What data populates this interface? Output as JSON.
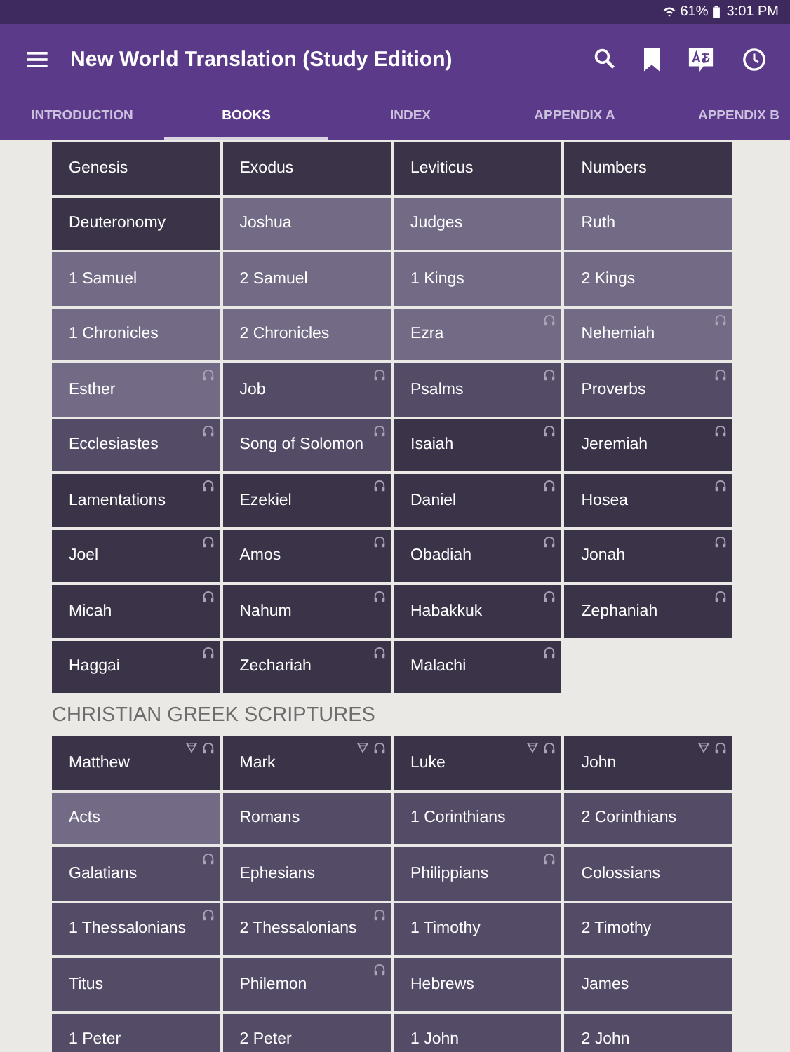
{
  "status_bar": {
    "battery": "61%",
    "time": "3:01 PM"
  },
  "app_bar": {
    "title": "New World Translation (Study Edition)"
  },
  "tabs": [
    {
      "label": "INTRODUCTION",
      "selected": false
    },
    {
      "label": "BOOKS",
      "selected": true
    },
    {
      "label": "INDEX",
      "selected": false
    },
    {
      "label": "APPENDIX A",
      "selected": false
    },
    {
      "label": "APPENDIX B",
      "selected": false
    }
  ],
  "sections": [
    {
      "books": [
        {
          "name": "Genesis",
          "color": "#3b3448",
          "audio": false,
          "study": false
        },
        {
          "name": "Exodus",
          "color": "#3b3448",
          "audio": false,
          "study": false
        },
        {
          "name": "Leviticus",
          "color": "#3b3448",
          "audio": false,
          "study": false
        },
        {
          "name": "Numbers",
          "color": "#3b3448",
          "audio": false,
          "study": false
        },
        {
          "name": "Deuteronomy",
          "color": "#3b3448",
          "audio": false,
          "study": false
        },
        {
          "name": "Joshua",
          "color": "#736a85",
          "audio": false,
          "study": false
        },
        {
          "name": "Judges",
          "color": "#736a85",
          "audio": false,
          "study": false
        },
        {
          "name": "Ruth",
          "color": "#736a85",
          "audio": false,
          "study": false
        },
        {
          "name": "1 Samuel",
          "color": "#736a85",
          "audio": false,
          "study": false
        },
        {
          "name": "2 Samuel",
          "color": "#736a85",
          "audio": false,
          "study": false
        },
        {
          "name": "1 Kings",
          "color": "#736a85",
          "audio": false,
          "study": false
        },
        {
          "name": "2 Kings",
          "color": "#736a85",
          "audio": false,
          "study": false
        },
        {
          "name": "1 Chronicles",
          "color": "#736a85",
          "audio": false,
          "study": false
        },
        {
          "name": "2 Chronicles",
          "color": "#736a85",
          "audio": false,
          "study": false
        },
        {
          "name": "Ezra",
          "color": "#736a85",
          "audio": true,
          "study": false
        },
        {
          "name": "Nehemiah",
          "color": "#736a85",
          "audio": true,
          "study": false
        },
        {
          "name": "Esther",
          "color": "#736a85",
          "audio": true,
          "study": false
        },
        {
          "name": "Job",
          "color": "#544b66",
          "audio": true,
          "study": false
        },
        {
          "name": "Psalms",
          "color": "#544b66",
          "audio": true,
          "study": false
        },
        {
          "name": "Proverbs",
          "color": "#544b66",
          "audio": true,
          "study": false
        },
        {
          "name": "Ecclesiastes",
          "color": "#544b66",
          "audio": true,
          "study": false
        },
        {
          "name": "Song of Solomon",
          "color": "#544b66",
          "audio": true,
          "study": false
        },
        {
          "name": "Isaiah",
          "color": "#3b3448",
          "audio": true,
          "study": false
        },
        {
          "name": "Jeremiah",
          "color": "#3b3448",
          "audio": true,
          "study": false
        },
        {
          "name": "Lamentations",
          "color": "#3b3448",
          "audio": true,
          "study": false
        },
        {
          "name": "Ezekiel",
          "color": "#3b3448",
          "audio": true,
          "study": false
        },
        {
          "name": "Daniel",
          "color": "#3b3448",
          "audio": true,
          "study": false
        },
        {
          "name": "Hosea",
          "color": "#3b3448",
          "audio": true,
          "study": false
        },
        {
          "name": "Joel",
          "color": "#3b3448",
          "audio": true,
          "study": false
        },
        {
          "name": "Amos",
          "color": "#3b3448",
          "audio": true,
          "study": false
        },
        {
          "name": "Obadiah",
          "color": "#3b3448",
          "audio": true,
          "study": false
        },
        {
          "name": "Jonah",
          "color": "#3b3448",
          "audio": true,
          "study": false
        },
        {
          "name": "Micah",
          "color": "#3b3448",
          "audio": true,
          "study": false
        },
        {
          "name": "Nahum",
          "color": "#3b3448",
          "audio": true,
          "study": false
        },
        {
          "name": "Habakkuk",
          "color": "#3b3448",
          "audio": true,
          "study": false
        },
        {
          "name": "Zephaniah",
          "color": "#3b3448",
          "audio": true,
          "study": false
        },
        {
          "name": "Haggai",
          "color": "#3b3448",
          "audio": true,
          "study": false
        },
        {
          "name": "Zechariah",
          "color": "#3b3448",
          "audio": true,
          "study": false
        },
        {
          "name": "Malachi",
          "color": "#3b3448",
          "audio": true,
          "study": false
        }
      ]
    },
    {
      "heading": "CHRISTIAN GREEK SCRIPTURES",
      "books": [
        {
          "name": "Matthew",
          "color": "#3b3448",
          "audio": true,
          "study": true
        },
        {
          "name": "Mark",
          "color": "#3b3448",
          "audio": true,
          "study": true
        },
        {
          "name": "Luke",
          "color": "#3b3448",
          "audio": true,
          "study": true
        },
        {
          "name": "John",
          "color": "#3b3448",
          "audio": true,
          "study": true
        },
        {
          "name": "Acts",
          "color": "#736a85",
          "audio": false,
          "study": false
        },
        {
          "name": "Romans",
          "color": "#544b66",
          "audio": false,
          "study": false
        },
        {
          "name": "1 Corinthians",
          "color": "#544b66",
          "audio": false,
          "study": false
        },
        {
          "name": "2 Corinthians",
          "color": "#544b66",
          "audio": false,
          "study": false
        },
        {
          "name": "Galatians",
          "color": "#544b66",
          "audio": true,
          "study": false
        },
        {
          "name": "Ephesians",
          "color": "#544b66",
          "audio": false,
          "study": false
        },
        {
          "name": "Philippians",
          "color": "#544b66",
          "audio": true,
          "study": false
        },
        {
          "name": "Colossians",
          "color": "#544b66",
          "audio": false,
          "study": false
        },
        {
          "name": "1 Thessalonians",
          "color": "#544b66",
          "audio": true,
          "study": false
        },
        {
          "name": "2 Thessalonians",
          "color": "#544b66",
          "audio": true,
          "study": false
        },
        {
          "name": "1 Timothy",
          "color": "#544b66",
          "audio": false,
          "study": false
        },
        {
          "name": "2 Timothy",
          "color": "#544b66",
          "audio": false,
          "study": false
        },
        {
          "name": "Titus",
          "color": "#544b66",
          "audio": false,
          "study": false
        },
        {
          "name": "Philemon",
          "color": "#544b66",
          "audio": true,
          "study": false
        },
        {
          "name": "Hebrews",
          "color": "#544b66",
          "audio": false,
          "study": false
        },
        {
          "name": "James",
          "color": "#544b66",
          "audio": false,
          "study": false
        },
        {
          "name": "1 Peter",
          "color": "#544b66",
          "audio": false,
          "study": false
        },
        {
          "name": "2 Peter",
          "color": "#544b66",
          "audio": false,
          "study": false
        },
        {
          "name": "1 John",
          "color": "#544b66",
          "audio": false,
          "study": false
        },
        {
          "name": "2 John",
          "color": "#544b66",
          "audio": false,
          "study": false
        }
      ]
    }
  ]
}
